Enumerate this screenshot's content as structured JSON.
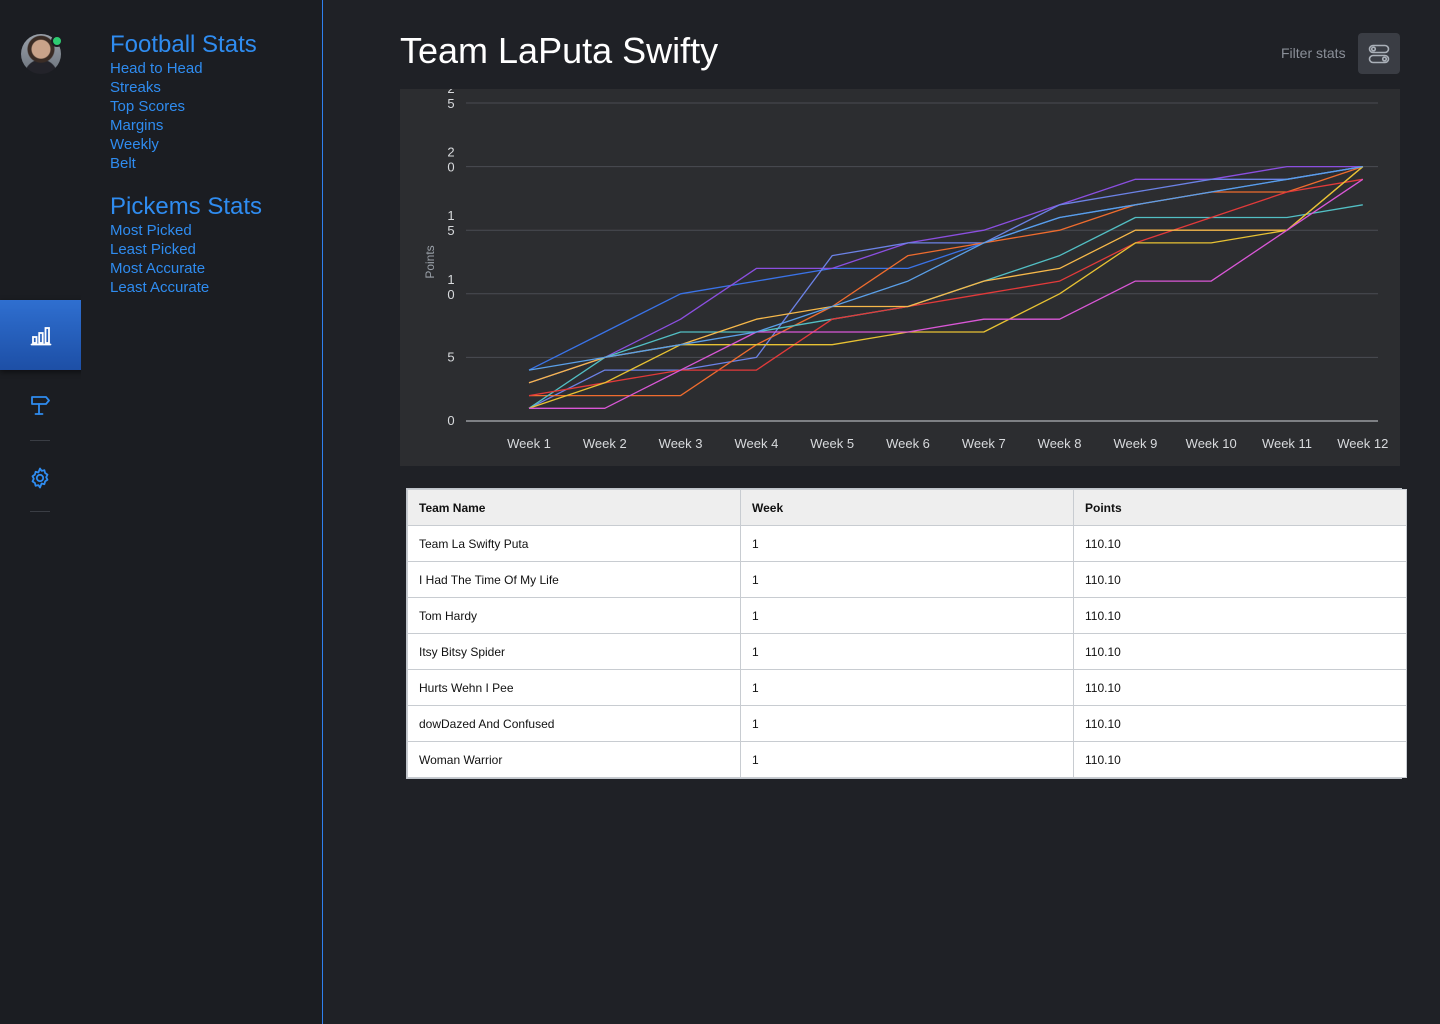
{
  "header": {
    "title": "Team LaPuta Swifty",
    "filter_label": "Filter stats"
  },
  "rail": {
    "items": [
      {
        "name": "stats",
        "icon": "bar-chart-icon",
        "active": true
      },
      {
        "name": "pickems",
        "icon": "signpost-icon",
        "active": false
      },
      {
        "name": "settings",
        "icon": "gear-icon",
        "active": false
      }
    ]
  },
  "nav": {
    "football": {
      "heading": "Football Stats",
      "links": [
        "Head to Head",
        "Streaks",
        "Top Scores",
        "Margins",
        "Weekly",
        "Belt"
      ]
    },
    "pickems": {
      "heading": "Pickems Stats",
      "links": [
        "Most Picked",
        "Least Picked",
        "Most Accurate",
        "Least Accurate"
      ]
    }
  },
  "colors": {
    "accent": "#2f8cf0",
    "background": "#1f2126",
    "sidebar": "#1b1d22",
    "chart_background": "#2c2d30"
  },
  "chart_data": {
    "type": "line",
    "title": "",
    "xlabel": "",
    "ylabel": "Points",
    "categories": [
      "Week 1",
      "Week 2",
      "Week 3",
      "Week 4",
      "Week 5",
      "Week 6",
      "Week 7",
      "Week 8",
      "Week 9",
      "Week 10",
      "Week 11",
      "Week 12"
    ],
    "ylim": [
      0,
      25
    ],
    "yticks": [
      {
        "value": 0,
        "label": "0"
      },
      {
        "value": 5,
        "label": "5"
      },
      {
        "value": 10,
        "label": "1\n0"
      },
      {
        "value": 15,
        "label": "1\n5"
      },
      {
        "value": 20,
        "label": "2\n0"
      },
      {
        "value": 25,
        "label": "2\n5"
      }
    ],
    "grid": true,
    "series": [
      {
        "color": "#3a73e8",
        "values": [
          4,
          7,
          10,
          11,
          12,
          12,
          14,
          16,
          17,
          18,
          19,
          20
        ]
      },
      {
        "color": "#8b4fe0",
        "values": [
          3,
          5,
          8,
          12,
          12,
          14,
          15,
          17,
          19,
          19,
          20,
          20
        ]
      },
      {
        "color": "#6c82e6",
        "values": [
          1,
          4,
          4,
          5,
          13,
          14,
          14,
          17,
          18,
          19,
          19,
          20
        ]
      },
      {
        "color": "#ef6c2e",
        "values": [
          2,
          2,
          2,
          6,
          9,
          13,
          14,
          15,
          17,
          18,
          18,
          20
        ]
      },
      {
        "color": "#52bfc4",
        "values": [
          1,
          5,
          7,
          7,
          8,
          9,
          11,
          13,
          16,
          16,
          16,
          17
        ]
      },
      {
        "color": "#e23a3a",
        "values": [
          2,
          3,
          4,
          4,
          8,
          9,
          10,
          11,
          14,
          16,
          18,
          19
        ]
      },
      {
        "color": "#f6b84a",
        "values": [
          3,
          5,
          6,
          8,
          9,
          9,
          11,
          12,
          15,
          15,
          15,
          20
        ]
      },
      {
        "color": "#e8c233",
        "values": [
          1,
          3,
          6,
          6,
          6,
          7,
          7,
          10,
          14,
          14,
          15,
          20
        ]
      },
      {
        "color": "#d957d6",
        "values": [
          1,
          1,
          4,
          7,
          7,
          7,
          8,
          8,
          11,
          11,
          15,
          19
        ]
      },
      {
        "color": "#5a9fe8",
        "values": [
          4,
          5,
          6,
          7,
          9,
          11,
          14,
          16,
          17,
          18,
          19,
          20
        ]
      }
    ]
  },
  "table": {
    "columns": [
      "Team Name",
      "Week",
      "Points"
    ],
    "rows": [
      [
        "Team La Swifty Puta",
        "1",
        "110.10"
      ],
      [
        "I Had The Time Of My Life",
        "1",
        "110.10"
      ],
      [
        "Tom Hardy",
        "1",
        "110.10"
      ],
      [
        "Itsy Bitsy Spider",
        "1",
        "110.10"
      ],
      [
        "Hurts Wehn I Pee",
        "1",
        "110.10"
      ],
      [
        "dowDazed And Confused",
        "1",
        "110.10"
      ],
      [
        "Woman Warrior",
        "1",
        "110.10"
      ]
    ]
  }
}
